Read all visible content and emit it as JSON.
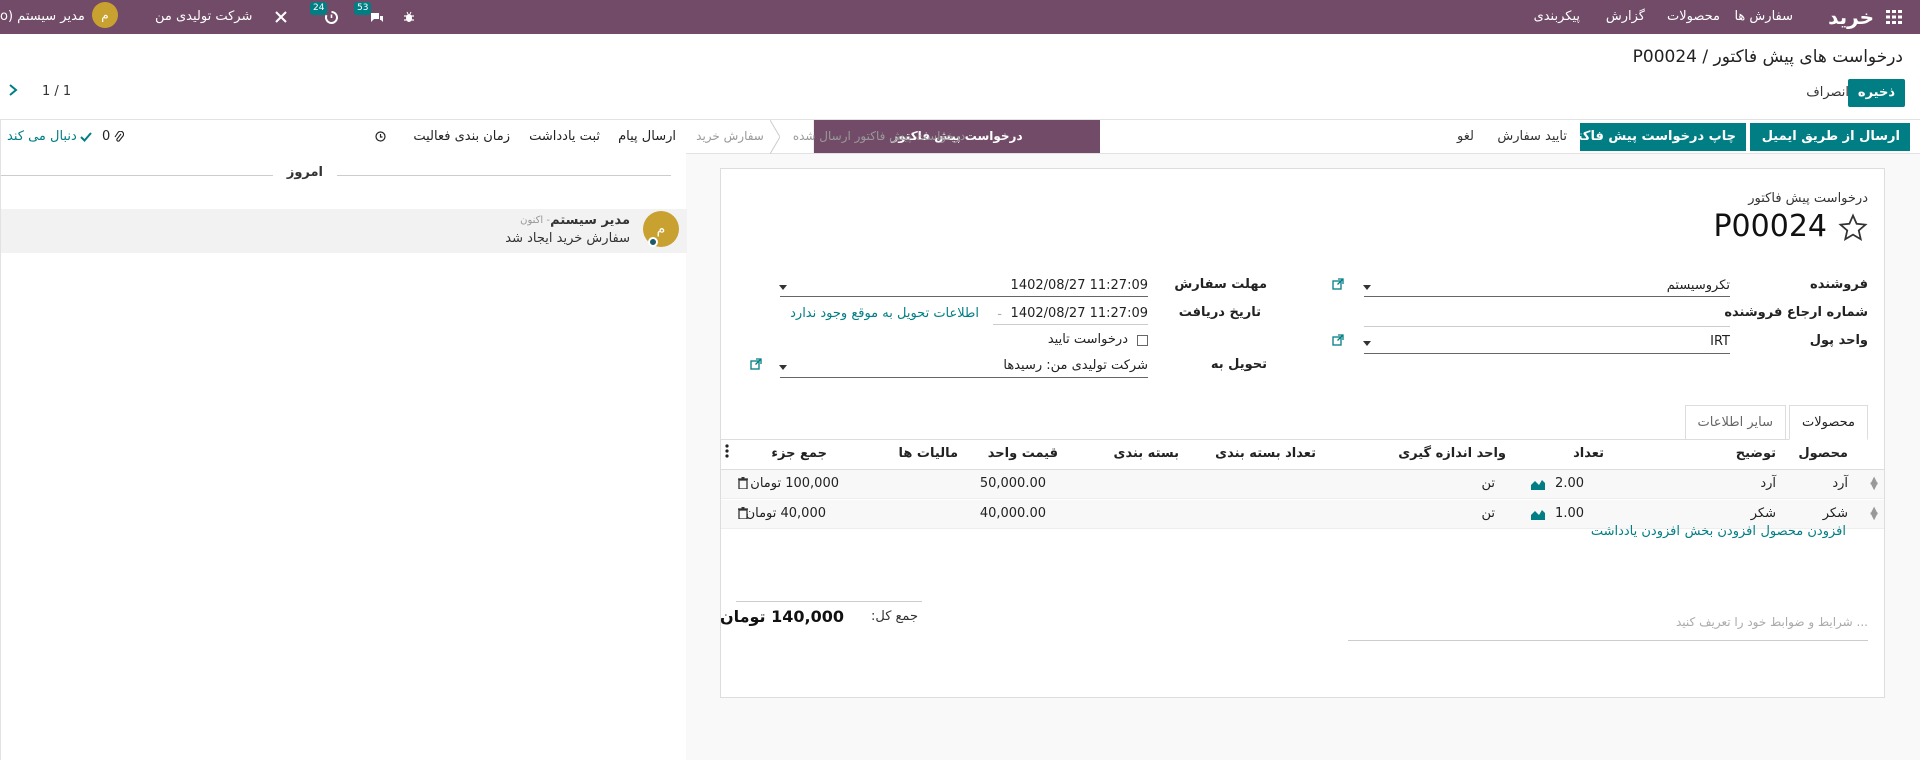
{
  "topbar": {
    "brand": "خرید",
    "menu": [
      "سفارش ها",
      "محصولات",
      "گزارش",
      "پیکربندی"
    ],
    "company": "شرکت تولیدی من",
    "user": "مدیر سیستم (o",
    "user_initial": "م",
    "badge_messages": "53",
    "badge_activities": "24"
  },
  "control": {
    "breadcrumb": "درخواست های پیش فاکتور / P00024",
    "save": "ذخیره",
    "discard": "انصراف",
    "pager": "1 / 1"
  },
  "statusbar": {
    "buttons": [
      "ارسال از طریق ایمیل",
      "چاپ درخواست پیش فاکتور",
      "تایید سفارش",
      "لغو"
    ],
    "stages": [
      "درخواست پیش فاکتور",
      "درخواست پیش فاکتور ارسال شده",
      "سفارش خرید"
    ]
  },
  "form": {
    "doc_type": "درخواست پیش فاکتور",
    "number": "P00024",
    "fields": {
      "vendor_label": "فروشنده",
      "vendor": "تکروسیستم",
      "vendor_ref_label": "شماره ارجاع فروشنده",
      "currency_label": "واحد پول",
      "currency": "IRT",
      "deadline_label": "مهلت سفارش",
      "deadline": "1402/08/27 11:27:09",
      "receipt_label": "تاریخ دریافت",
      "receipt": "1402/08/27 11:27:09",
      "receipt_note": "اطلاعات تحویل به موقع وجود ندارد",
      "confirm_label": "درخواست تایید",
      "deliver_to_label": "تحویل به",
      "deliver_to": "شرکت تولیدی من: رسیدها"
    },
    "tabs": [
      "محصولات",
      "سایر اطلاعات"
    ],
    "columns": [
      "محصول",
      "توضیح",
      "تعداد",
      "واحد اندازه گیری",
      "تعداد بسته بندی",
      "بسته بندی",
      "قیمت واحد",
      "مالیات ها",
      "جمع جزء"
    ],
    "lines": [
      {
        "product": "آرد",
        "description": "آرد",
        "qty": "2.00",
        "uom": "تن",
        "price": "50,000.00",
        "subtotal": "100,000 تومان"
      },
      {
        "product": "شکر",
        "description": "شکر",
        "qty": "1.00",
        "uom": "تن",
        "price": "40,000.00",
        "subtotal": "40,000 تومان"
      }
    ],
    "add_links": [
      "افزودن محصول",
      "افزودن بخش",
      "افزودن یادداشت"
    ],
    "terms_placeholder": "... شرایط و ضوابط خود را تعریف کنید",
    "total_label": "جمع کل:",
    "total": "140,000 تومان"
  },
  "chatter": {
    "send_message": "ارسال پیام",
    "log_note": "ثبت یادداشت",
    "schedule_activity": "زمان بندی فعالیت",
    "attachments": "0",
    "following": "دنبال می کند",
    "date": "امروز",
    "message": {
      "author": "مدیر سیستم",
      "time": "- اکنون",
      "body": "سفارش خرید ایجاد شد",
      "initial": "م"
    }
  }
}
